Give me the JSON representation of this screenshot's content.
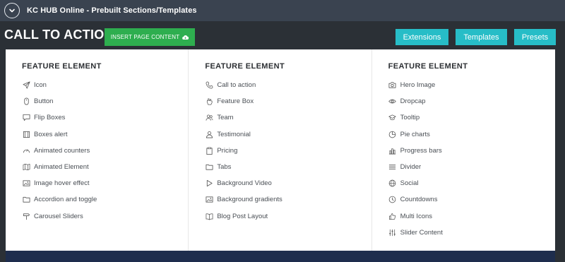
{
  "topbar": {
    "title": "KC HUB Online - Prebuilt Sections/Templates",
    "toggle_icon": "chevron-down-icon"
  },
  "header": {
    "section_title": "CALL TO ACTION",
    "insert_label": "INSERT PAGE CONTENT",
    "insert_icon": "cloud-download-icon",
    "tabs": [
      {
        "label": "Extensions"
      },
      {
        "label": "Templates"
      },
      {
        "label": "Presets"
      }
    ]
  },
  "colors": {
    "accent_teal": "#27bdc7",
    "insert_green": "#2eae4f",
    "dark_bg": "#2b3036",
    "topbar_bg": "#3a4350",
    "footer_navy": "#1e2d4d"
  },
  "columns": [
    {
      "heading": "FEATURE ELEMENT",
      "items": [
        {
          "label": "Icon",
          "icon": "send-icon"
        },
        {
          "label": "Button",
          "icon": "mouse-icon"
        },
        {
          "label": "Flip Boxes",
          "icon": "comment-icon"
        },
        {
          "label": "Boxes alert",
          "icon": "box-icon"
        },
        {
          "label": "Animated counters",
          "icon": "gauge-icon"
        },
        {
          "label": "Animated Element",
          "icon": "map-icon"
        },
        {
          "label": "Image hover effect",
          "icon": "image-icon"
        },
        {
          "label": "Accordion and toggle",
          "icon": "folder-icon"
        },
        {
          "label": "Carousel Sliders",
          "icon": "signpost-icon"
        }
      ]
    },
    {
      "heading": "FEATURE ELEMENT",
      "items": [
        {
          "label": "Call to action",
          "icon": "phone-icon"
        },
        {
          "label": "Feature Box",
          "icon": "hand-icon"
        },
        {
          "label": "Team",
          "icon": "users-icon"
        },
        {
          "label": "Testimonial",
          "icon": "user-icon"
        },
        {
          "label": "Pricing",
          "icon": "clipboard-icon"
        },
        {
          "label": "Tabs",
          "icon": "folder-icon"
        },
        {
          "label": "Background Video",
          "icon": "play-icon"
        },
        {
          "label": "Background gradients",
          "icon": "image-icon"
        },
        {
          "label": "Blog Post Layout",
          "icon": "book-icon"
        }
      ]
    },
    {
      "heading": "FEATURE ELEMENT",
      "items": [
        {
          "label": "Hero Image",
          "icon": "camera-icon"
        },
        {
          "label": "Dropcap",
          "icon": "eye-icon"
        },
        {
          "label": "Tooltip",
          "icon": "graduation-cap-icon"
        },
        {
          "label": "Pie charts",
          "icon": "pie-chart-icon"
        },
        {
          "label": "Progress bars",
          "icon": "bar-chart-icon"
        },
        {
          "label": "Divider",
          "icon": "menu-icon"
        },
        {
          "label": "Social",
          "icon": "globe-icon"
        },
        {
          "label": "Countdowns",
          "icon": "clock-icon"
        },
        {
          "label": "Multi Icons",
          "icon": "thumbs-up-icon"
        },
        {
          "label": "Slider Content",
          "icon": "sliders-icon"
        }
      ]
    }
  ]
}
